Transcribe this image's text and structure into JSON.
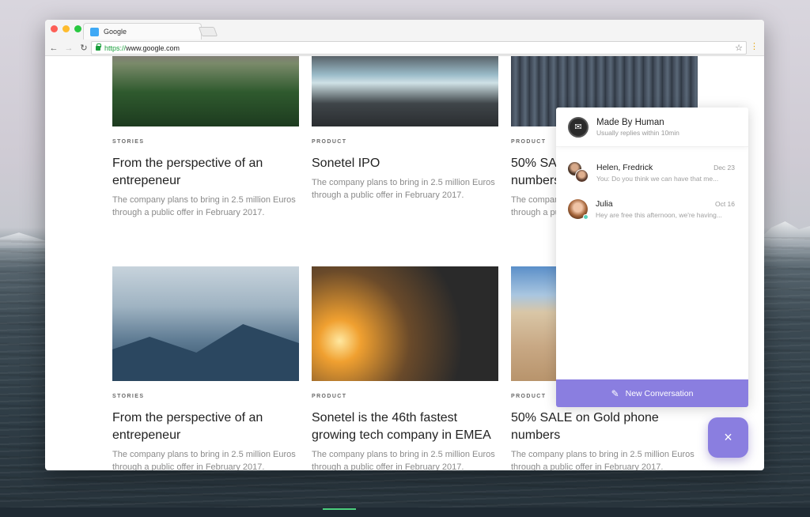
{
  "browser": {
    "tab_title": "Google",
    "url_scheme": "https://",
    "url_rest": "www.google.com"
  },
  "cards": [
    {
      "category": "STORIES",
      "title": "From the perspective of an entrepeneur",
      "desc": "The company plans to bring in 2.5 million Euros through a public offer in February 2017."
    },
    {
      "category": "PRODUCT",
      "title": "Sonetel IPO",
      "desc": "The company plans to bring in 2.5 million Euros through a public offer in February 2017."
    },
    {
      "category": "PRODUCT",
      "title": "50% SALE on Gold phone numbers",
      "desc": "The company plans to bring in 2.5 million Euros through a public offer in February 2017."
    },
    {
      "category": "STORIES",
      "title": "From the perspective of an entrepeneur",
      "desc": "The company plans to bring in 2.5 million Euros through a public offer in February 2017."
    },
    {
      "category": "PRODUCT",
      "title": "Sonetel is the 46th fastest growing tech company in EMEA",
      "desc": "The company plans to bring in 2.5 million Euros through a public offer in February 2017."
    },
    {
      "category": "PRODUCT",
      "title": "50% SALE on Gold phone numbers",
      "desc": "The company plans to bring in 2.5 million Euros through a public offer in February 2017."
    }
  ],
  "chat": {
    "team_name": "Made By Human",
    "reply_time": "Usually replies within 10min",
    "conversations": [
      {
        "name": "Helen, Fredrick",
        "date": "Dec 23",
        "preview": "You: Do you think we can have that me..."
      },
      {
        "name": "Julia",
        "date": "Oct 16",
        "preview": "Hey are free this afternoon, we're having..."
      }
    ],
    "new_conversation_label": "New Conversation",
    "accent_color": "#8a7ee0"
  },
  "icons": {
    "close": "×",
    "pencil": "✎",
    "star": "☆",
    "back": "←",
    "forward": "→",
    "reload": "↻",
    "menu": "⋮"
  }
}
